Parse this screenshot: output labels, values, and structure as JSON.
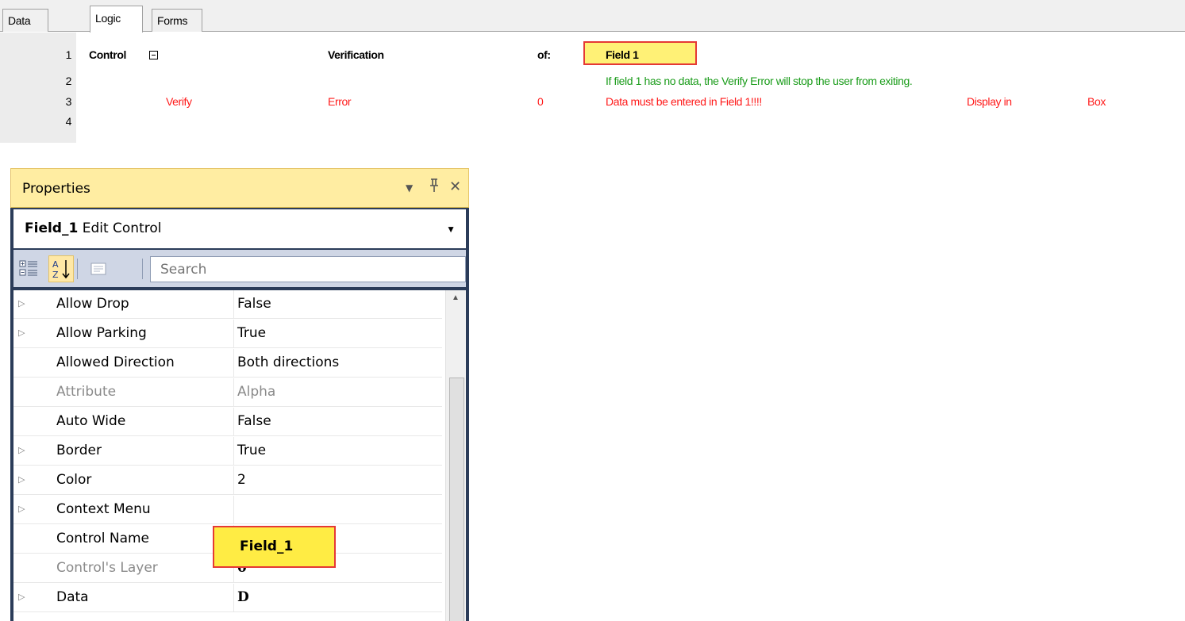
{
  "tabs": [
    "Data View",
    "Logic",
    "Forms"
  ],
  "logic": {
    "lines": [
      {
        "num": "1",
        "col1": "Control",
        "col2": "Verification",
        "col3": "of:",
        "col4": "Field 1"
      },
      {
        "num": "2",
        "comment": "If field 1 has no data, the Verify Error will stop the user from exiting."
      },
      {
        "num": "3",
        "col1": "Verify",
        "col2": "Error",
        "col3": "0",
        "col4": "Data must be entered in Field 1!!!!",
        "col5": "Display in",
        "col6": "Box"
      },
      {
        "num": "4"
      }
    ],
    "colors": {
      "keyword": "#000000",
      "error": "#ff1a1a",
      "comment": "#1a9c1a",
      "highlight": "#fff176"
    }
  },
  "properties": {
    "title": "Properties",
    "object_name": "Field_1",
    "object_type": "Edit Control",
    "search_placeholder": "Search",
    "rows": [
      {
        "name": "Allow Drop",
        "value": "False",
        "expandable": true
      },
      {
        "name": "Allow Parking",
        "value": "True",
        "expandable": true
      },
      {
        "name": "Allowed Direction",
        "value": "Both directions",
        "expandable": false
      },
      {
        "name": "Attribute",
        "value": "Alpha",
        "expandable": false,
        "disabled": true
      },
      {
        "name": "Auto Wide",
        "value": "False",
        "expandable": false
      },
      {
        "name": "Border",
        "value": "True",
        "expandable": true
      },
      {
        "name": "Color",
        "value": "2",
        "expandable": true
      },
      {
        "name": "Context Menu",
        "value": "",
        "expandable": true
      },
      {
        "name": "Control Name",
        "value": "Field_1",
        "expandable": false
      },
      {
        "name": "Control's Layer",
        "value": "0",
        "expandable": false,
        "disabled": true
      },
      {
        "name": "Data",
        "value": "D",
        "expandable": true
      }
    ],
    "colors": {
      "titlebar": "#ffeda2",
      "frame": "#2b3c59",
      "toolbar": "#cfd6e5",
      "highlight": "#ffec44"
    }
  }
}
